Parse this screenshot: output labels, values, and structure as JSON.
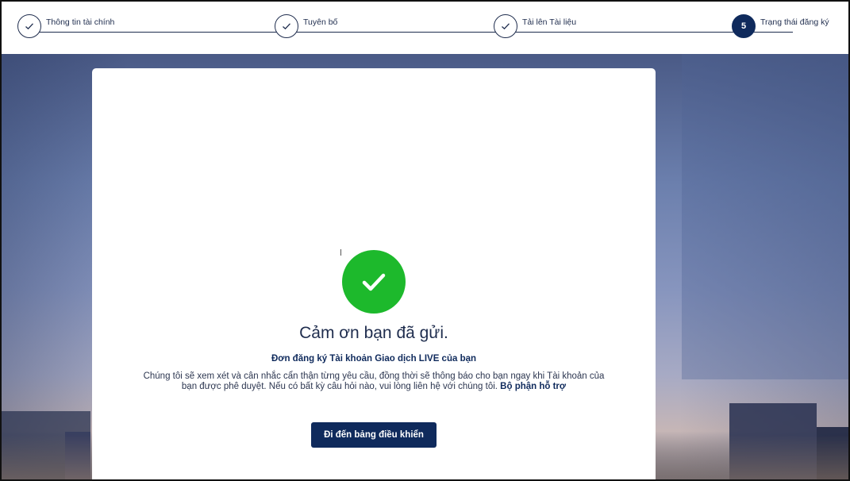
{
  "stepper": {
    "steps": [
      {
        "label": "Thông tin tài chính",
        "status": "done"
      },
      {
        "label": "Tuyên bố",
        "status": "done"
      },
      {
        "label": "Tải lên Tài liệu",
        "status": "done"
      },
      {
        "label": "Trạng thái đăng ký",
        "status": "active",
        "number": "5"
      }
    ]
  },
  "confirmation": {
    "title": "Cảm ơn bạn đã gửi.",
    "subtitle": "Đơn đăng ký Tài khoản Giao dịch LIVE của bạn",
    "body": "Chúng tôi sẽ xem xét và cân nhắc cẩn thận từng yêu cầu, đồng thời sẽ thông báo cho bạn ngay khi Tài khoản của bạn được phê duyệt. Nếu có bất kỳ câu hỏi nào, vui lòng liên hệ với chúng tôi.",
    "support_link": "Bộ phận hỗ trợ",
    "button_label": "Đi đến bảng điều khiển"
  },
  "colors": {
    "primary": "#0f2a5c",
    "success": "#1db92c"
  },
  "icons": {
    "done_step": "check-icon",
    "success": "check-circle-icon"
  }
}
